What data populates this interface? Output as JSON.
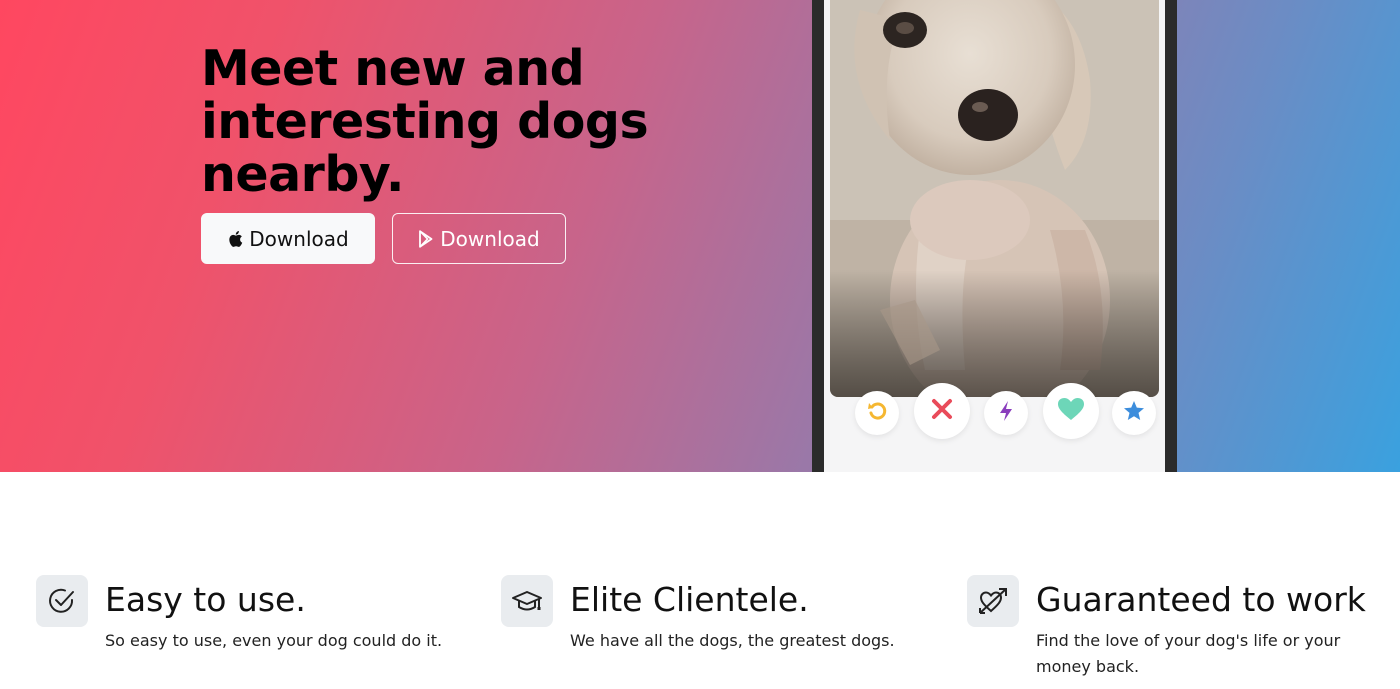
{
  "hero": {
    "headline": "Meet new and interesting dogs nearby.",
    "buttons": {
      "apple_download": {
        "label": "Download",
        "icon": "apple-icon"
      },
      "play_download": {
        "label": "Download",
        "icon": "google-play-icon"
      }
    },
    "gradient": {
      "start": "#ff4760",
      "middle": "#9a78a8",
      "end": "#3aa1df"
    }
  },
  "phone": {
    "photo": "dog-photo",
    "actions": [
      {
        "name": "rewind-icon",
        "color": "#f5b731"
      },
      {
        "name": "nope-icon",
        "color": "#e94b5a"
      },
      {
        "name": "boost-icon",
        "color": "#8a3dbd"
      },
      {
        "name": "like-icon",
        "color": "#6dd6b8"
      },
      {
        "name": "super-like-icon",
        "color": "#3c8ddc"
      }
    ]
  },
  "features": [
    {
      "icon": "check-circle-icon",
      "title": "Easy to use.",
      "description": "So easy to use, even your dog could do it."
    },
    {
      "icon": "graduation-cap-icon",
      "title": "Elite Clientele.",
      "description": "We have all the dogs, the greatest dogs."
    },
    {
      "icon": "heart-arrow-icon",
      "title": "Guaranteed to work",
      "description": "Find the love of your dog's life or your money back."
    }
  ]
}
